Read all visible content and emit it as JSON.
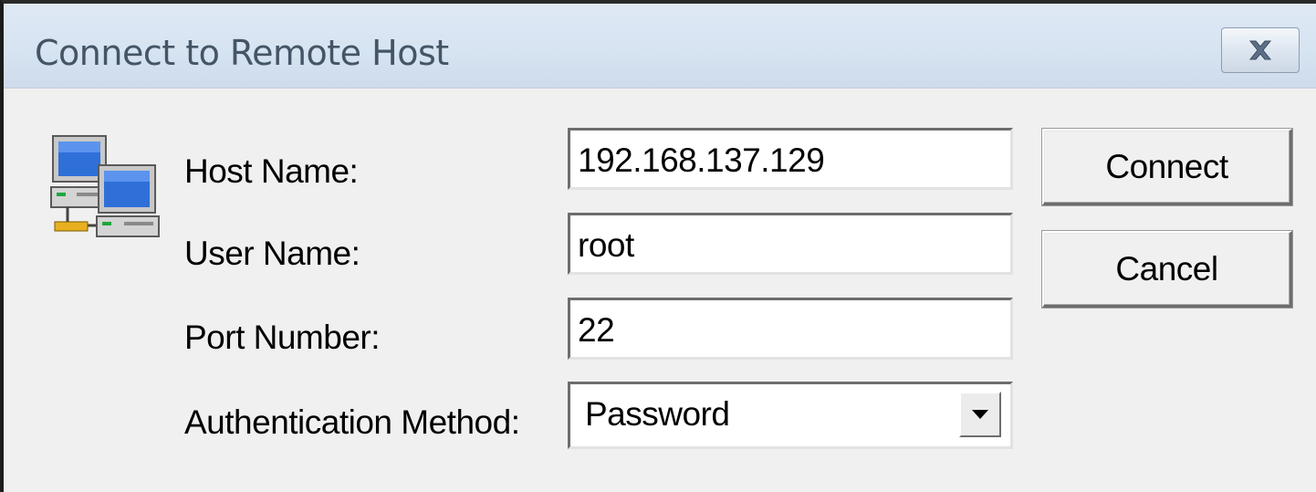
{
  "window": {
    "title": "Connect to Remote Host"
  },
  "icons": {
    "close": "close-icon",
    "network": "network-computers-icon",
    "dropdown": "dropdown-arrow-icon"
  },
  "form": {
    "host_name_label": "Host Name:",
    "host_name_value": "192.168.137.129",
    "user_name_label": "User Name:",
    "user_name_value": "root",
    "port_number_label": "Port Number:",
    "port_number_value": "22",
    "auth_method_label": "Authentication Method:",
    "auth_method_value": "Password"
  },
  "buttons": {
    "connect_label": "Connect",
    "cancel_label": "Cancel"
  },
  "colors": {
    "titlebar": "#d6e3f1",
    "title_text": "#445566",
    "dialog_background": "#f0f0f0"
  }
}
